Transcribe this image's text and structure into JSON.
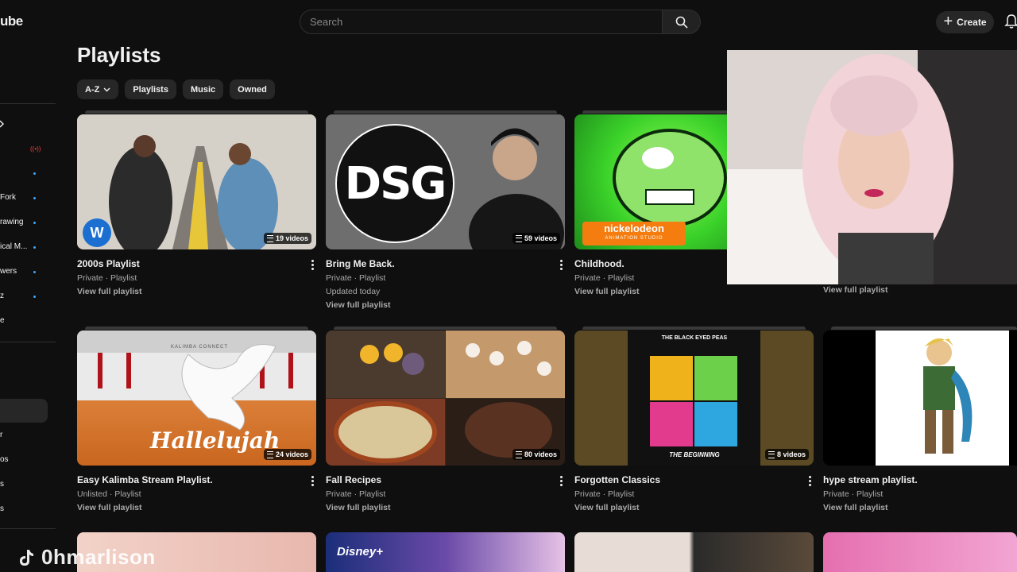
{
  "header": {
    "logo": "ube",
    "search_placeholder": "Search",
    "create_label": "Create"
  },
  "sidebar": {
    "items": [
      "Fork",
      "rawing",
      "ical M...",
      "wers",
      "z",
      "e",
      "r",
      "os",
      "s",
      "s"
    ]
  },
  "page": {
    "title": "Playlists",
    "chips": [
      {
        "label": "A-Z",
        "dropdown": true
      },
      {
        "label": "Playlists"
      },
      {
        "label": "Music"
      },
      {
        "label": "Owned"
      }
    ]
  },
  "playlists": [
    {
      "title": "2000s Playlist",
      "meta": "Private · Playlist",
      "view": "View full playlist",
      "count": "19 videos"
    },
    {
      "title": "Bring Me Back.",
      "meta": "Private · Playlist",
      "updated": "Updated today",
      "view": "View full playlist",
      "count": "59 videos"
    },
    {
      "title": "Childhood.",
      "meta": "Private · Playlist",
      "view": "View full playlist"
    },
    {
      "view": "View full playlist"
    },
    {
      "title": "Easy Kalimba Stream Playlist.",
      "meta": "Unlisted · Playlist",
      "view": "View full playlist",
      "count": "24 videos"
    },
    {
      "title": "Fall Recipes",
      "meta": "Private · Playlist",
      "view": "View full playlist",
      "count": "80 videos"
    },
    {
      "title": "Forgotten Classics",
      "meta": "Private · Playlist",
      "view": "View full playlist",
      "count": "8 videos"
    },
    {
      "title": "hype stream playlist.",
      "meta": "Private · Playlist",
      "view": "View full playlist"
    }
  ],
  "thumb_text": {
    "dsg": "DSG",
    "nick": "nickelodeon",
    "nick_sub": "ANIMATION STUDIO",
    "kalimba": "Hallelujah",
    "kalimba_brand": "KALIMBA CONNECT",
    "bep_top": "THE BLACK EYED PEAS",
    "bep_bottom": "THE BEGINNING",
    "disney": "Disney+"
  },
  "watermark": "0hmarlison",
  "colors": {
    "background": "#0f0f0f",
    "chip": "#272727",
    "secondary_text": "#aaaaaa",
    "live": "#ff3d3d",
    "unread_dot": "#3ea6ff"
  }
}
